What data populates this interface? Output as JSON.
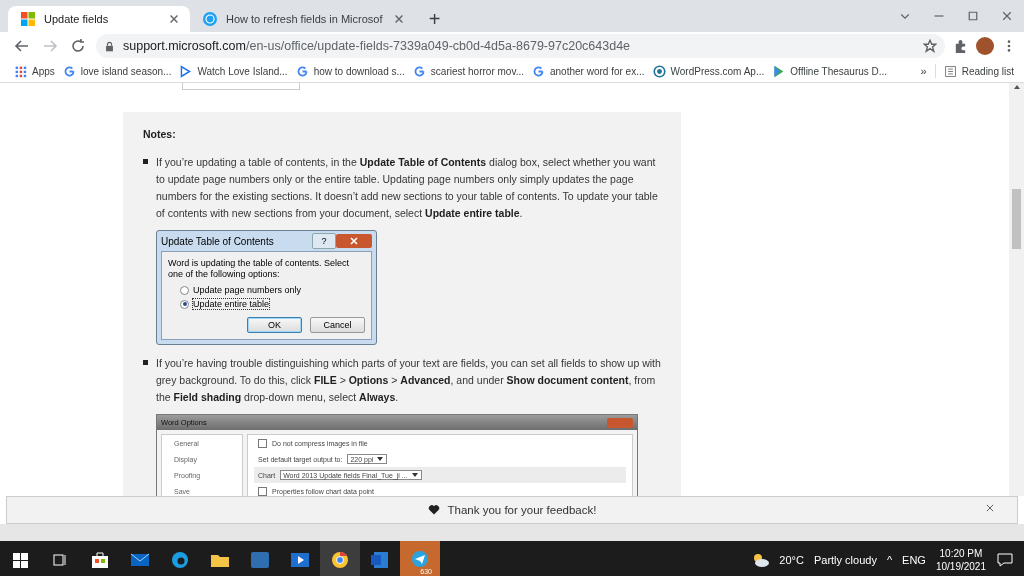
{
  "browser": {
    "tabs": [
      {
        "title": "Update fields",
        "kind": "office",
        "selected": true
      },
      {
        "title": "How to refresh fields in Microsof",
        "kind": "globe",
        "selected": false
      }
    ],
    "new_tab": "+",
    "url_host": "support.microsoft.com",
    "url_path": "/en-us/office/update-fields-7339a049-cb0d-4d5a-8679-97c20c643d4e",
    "bookmarks": [
      {
        "label": "Apps",
        "kind": "apps"
      },
      {
        "label": "love island season...",
        "kind": "google"
      },
      {
        "label": "Watch Love Island...",
        "kind": "video"
      },
      {
        "label": "how to download s...",
        "kind": "google"
      },
      {
        "label": "scariest horror mov...",
        "kind": "google"
      },
      {
        "label": "another word for ex...",
        "kind": "google"
      },
      {
        "label": "WordPress.com Ap...",
        "kind": "wordpress"
      },
      {
        "label": "Offline Thesaurus D...",
        "kind": "play"
      }
    ],
    "overflow": "»",
    "reading_list": "Reading list"
  },
  "article": {
    "heading": "Notes:",
    "notes": [
      {
        "text": "If you’re updating a table of contents, in the **Update Table of Contents** dialog box, select whether you want to update page numbers only or the entire table. Updating page numbers only simply updates the page numbers for the existing sections. It doesn’t add new sections to your table of contents. To update your table of contents with new sections from your document, select **Update entire table**.",
        "dialog": {
          "title": "Update Table of Contents",
          "help": "?",
          "message": "Word is updating the table of contents.  Select one of the following options:",
          "options": [
            {
              "label": "Update page numbers only",
              "selected": false
            },
            {
              "label": "Update entire table",
              "selected": true
            }
          ],
          "buttons": [
            {
              "label": "OK",
              "default": true
            },
            {
              "label": "Cancel",
              "default": false
            }
          ]
        }
      },
      {
        "text": "If you’re having trouble distinguishing which parts of your text are fields, you can set all fields to show up with grey background. To do this, click **FILE** > **Options** > **Advanced**, and under **Show document content**, from the **Field shading** drop-down menu, select **Always**.",
        "options_window": {
          "title": "Word Options",
          "nav": [
            "General",
            "Display",
            "Proofing",
            "Save"
          ],
          "rows": [
            {
              "kind": "checkbox",
              "label": "Do not compress images in file",
              "checked": false
            },
            {
              "kind": "dropdown",
              "label": "Set default target output to:",
              "value": "220 ppi"
            },
            {
              "kind": "section",
              "label": "Chart",
              "value": "Word 2013 Update fields Final_Tue_ji ..."
            },
            {
              "kind": "checkbox",
              "label": "Properties follow chart data point",
              "checked": false
            }
          ]
        }
      }
    ]
  },
  "feedback": {
    "message": "Thank you for your feedback!"
  },
  "taskbar": {
    "apps": [
      {
        "kind": "start",
        "selected": false,
        "attention": false
      },
      {
        "kind": "taskview",
        "selected": false,
        "attention": false
      },
      {
        "kind": "store",
        "selected": false,
        "attention": false
      },
      {
        "kind": "mail",
        "selected": false,
        "attention": false
      },
      {
        "kind": "edge",
        "selected": false,
        "attention": false
      },
      {
        "kind": "explorer",
        "selected": false,
        "attention": false
      },
      {
        "kind": "app",
        "selected": false,
        "attention": false
      },
      {
        "kind": "video",
        "selected": false,
        "attention": false
      },
      {
        "kind": "chrome",
        "selected": true,
        "attention": false
      },
      {
        "kind": "word",
        "selected": false,
        "attention": false
      },
      {
        "kind": "telegram",
        "selected": false,
        "attention": true,
        "badge": "630"
      }
    ],
    "temperature": "20°C",
    "weather": "Partly cloudy",
    "tray_caret": "^",
    "language": "ENG",
    "time": "10:20 PM",
    "date": "10/19/2021"
  }
}
